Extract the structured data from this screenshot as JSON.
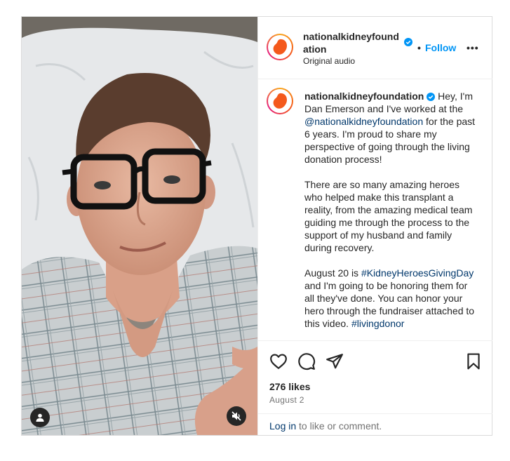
{
  "post": {
    "username": "nationalkidneyfoundation",
    "follow_label": "Follow",
    "dot": "•",
    "more_label": "•••",
    "audio_label": "Original audio",
    "caption": {
      "username": "nationalkidneyfoundation",
      "p1_a": " Hey, I'm Dan Emerson and I've worked at the ",
      "p1_mention": "@nationalkidneyfoundation",
      "p1_b": " for the past 6 years. I'm proud to share my perspective of going through the living donation process!",
      "p2": "There are so many amazing heroes who helped make this transplant a reality, from the amazing medical team guiding me through the process to the support of my husband and family during recovery.",
      "p3_a": "August 20 is ",
      "p3_tag1": "#KidneyHeroesGivingDay",
      "p3_b": " and I'm going to be honoring them for all they've done. You can honor your hero through the fundraiser attached to this video. ",
      "p3_tag2": "#livingdonor"
    },
    "likes": "276 likes",
    "date": "August 2",
    "login_link": "Log in",
    "login_rest": " to like or comment."
  },
  "icons": {
    "verified": "verified-badge-icon",
    "like": "heart-icon",
    "comment": "comment-icon",
    "share": "paper-plane-icon",
    "save": "bookmark-icon",
    "user_tag": "user-icon",
    "mute": "speaker-muted-icon"
  },
  "colors": {
    "accent": "#0095f6",
    "link": "#00376b",
    "brand": "#f4591c"
  }
}
